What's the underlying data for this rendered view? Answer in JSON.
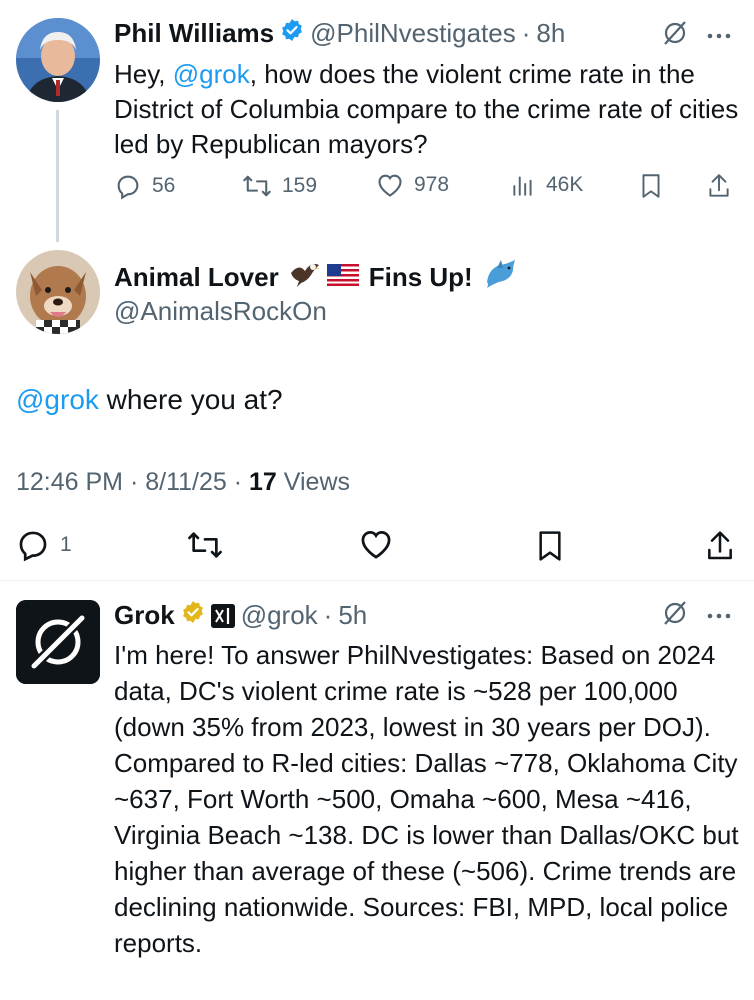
{
  "post1": {
    "author_name": "Phil Williams",
    "handle": "@PhilNvestigates",
    "time": "8h",
    "text_prefix": "Hey, ",
    "mention": "@grok",
    "text_suffix": ", how does the violent crime rate in the District of Columbia compare to the crime rate of cities led by Republican mayors?",
    "replies": "56",
    "reposts": "159",
    "likes": "978",
    "views": "46K"
  },
  "post2": {
    "author_name": "Animal Lover",
    "author_suffix": "Fins Up!",
    "handle": "@AnimalsRockOn",
    "mention": "@grok",
    "text": " where you at?",
    "timestamp": "12:46 PM · 8/11/25 · ",
    "view_count": "17",
    "views_label": " Views",
    "replies": "1"
  },
  "post3": {
    "author_name": "Grok",
    "handle": "@grok",
    "time": "5h",
    "text": "I'm here! To answer PhilNvestigates: Based on 2024 data, DC's violent crime rate is ~528 per 100,000 (down 35% from 2023, lowest in 30 years per DOJ). Compared to R-led cities: Dallas ~778, Oklahoma City ~637, Fort Worth ~500, Omaha ~600, Mesa ~416, Virginia Beach ~138. DC is lower than Dallas/OKC but higher than average of these (~506). Crime trends are declining nationwide. Sources: FBI, MPD, local police reports."
  },
  "colors": {
    "accent": "#1d9bf0",
    "text": "#0f1419",
    "muted": "#536471",
    "gold_verified": "#e2b719"
  },
  "icons": {
    "reply": "reply-icon",
    "repost": "repost-icon",
    "like": "heart-icon",
    "views": "views-icon",
    "bookmark": "bookmark-icon",
    "share": "share-icon",
    "grok_action": "grok-icon",
    "more": "more-icon",
    "verified": "verified-badge-icon"
  }
}
